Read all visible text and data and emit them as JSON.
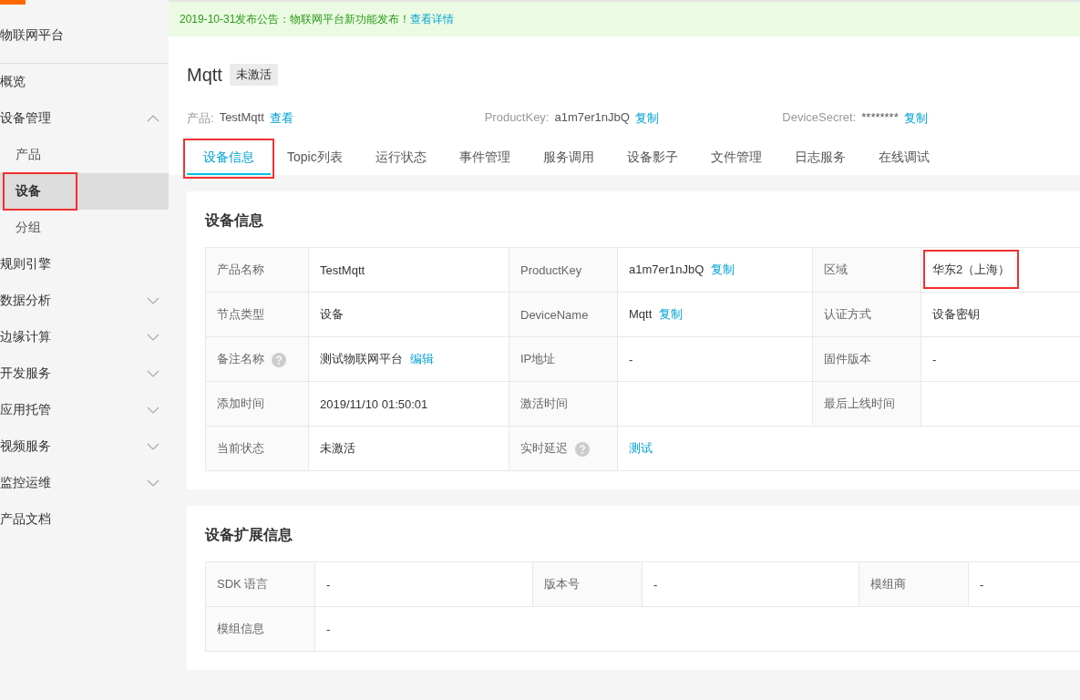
{
  "brand": "物联网平台",
  "sidebar": {
    "items": [
      {
        "label": "概览",
        "kind": "link"
      },
      {
        "label": "设备管理",
        "kind": "group",
        "expanded": true,
        "children": [
          {
            "label": "产品",
            "selected": false,
            "highlighted": false
          },
          {
            "label": "设备",
            "selected": true,
            "highlighted": true
          },
          {
            "label": "分组",
            "selected": false,
            "highlighted": false
          }
        ]
      },
      {
        "label": "规则引擎",
        "kind": "link"
      },
      {
        "label": "数据分析",
        "kind": "group",
        "expanded": false
      },
      {
        "label": "边缘计算",
        "kind": "group",
        "expanded": false
      },
      {
        "label": "开发服务",
        "kind": "group",
        "expanded": false
      },
      {
        "label": "应用托管",
        "kind": "group",
        "expanded": false
      },
      {
        "label": "视频服务",
        "kind": "group",
        "expanded": false
      },
      {
        "label": "监控运维",
        "kind": "group",
        "expanded": false
      },
      {
        "label": "产品文档",
        "kind": "link"
      }
    ]
  },
  "notice": {
    "text": "2019-10-31发布公告：物联网平台新功能发布！",
    "link": "查看详情"
  },
  "device": {
    "name": "Mqtt",
    "status": "未激活"
  },
  "meta": [
    {
      "label": "产品:",
      "value": "TestMqtt",
      "action": "查看"
    },
    {
      "label": "ProductKey:",
      "value": "a1m7er1nJbQ",
      "action": "复制"
    },
    {
      "label": "DeviceSecret:",
      "value": "********",
      "action": "复制"
    }
  ],
  "tabs": [
    {
      "label": "设备信息",
      "selected": true,
      "highlighted": true
    },
    {
      "label": "Topic列表",
      "selected": false,
      "highlighted": false
    },
    {
      "label": "运行状态",
      "selected": false,
      "highlighted": false
    },
    {
      "label": "事件管理",
      "selected": false,
      "highlighted": false
    },
    {
      "label": "服务调用",
      "selected": false,
      "highlighted": false
    },
    {
      "label": "设备影子",
      "selected": false,
      "highlighted": false
    },
    {
      "label": "文件管理",
      "selected": false,
      "highlighted": false
    },
    {
      "label": "日志服务",
      "selected": false,
      "highlighted": false
    },
    {
      "label": "在线调试",
      "selected": false,
      "highlighted": false
    }
  ],
  "info": {
    "title": "设备信息",
    "rows": [
      [
        {
          "label": "产品名称",
          "value": "TestMqtt"
        },
        {
          "label": "ProductKey",
          "value": "a1m7er1nJbQ",
          "link": "复制"
        },
        {
          "label": "区域",
          "value": "华东2（上海）",
          "highlighted": true
        }
      ],
      [
        {
          "label": "节点类型",
          "value": "设备"
        },
        {
          "label": "DeviceName",
          "value": "Mqtt",
          "link": "复制"
        },
        {
          "label": "认证方式",
          "value": "设备密钥"
        }
      ],
      [
        {
          "label": "备注名称",
          "help": true,
          "value": "测试物联网平台",
          "link": "编辑"
        },
        {
          "label": "IP地址",
          "value": "-"
        },
        {
          "label": "固件版本",
          "value": "-"
        }
      ],
      [
        {
          "label": "添加时间",
          "value": "2019/11/10 01:50:01"
        },
        {
          "label": "激活时间"
        },
        {
          "label": "最后上线时间"
        }
      ],
      [
        {
          "label": "当前状态",
          "value": "未激活"
        },
        {
          "label": "实时延迟",
          "help": true,
          "link": "测试"
        }
      ]
    ]
  },
  "ext": {
    "title": "设备扩展信息",
    "rows": [
      [
        {
          "label": "SDK 语言",
          "value": "-"
        },
        {
          "label": "版本号",
          "value": "-"
        },
        {
          "label": "模组商",
          "value": "-"
        }
      ],
      [
        {
          "label": "模组信息",
          "value": "-"
        }
      ]
    ]
  }
}
